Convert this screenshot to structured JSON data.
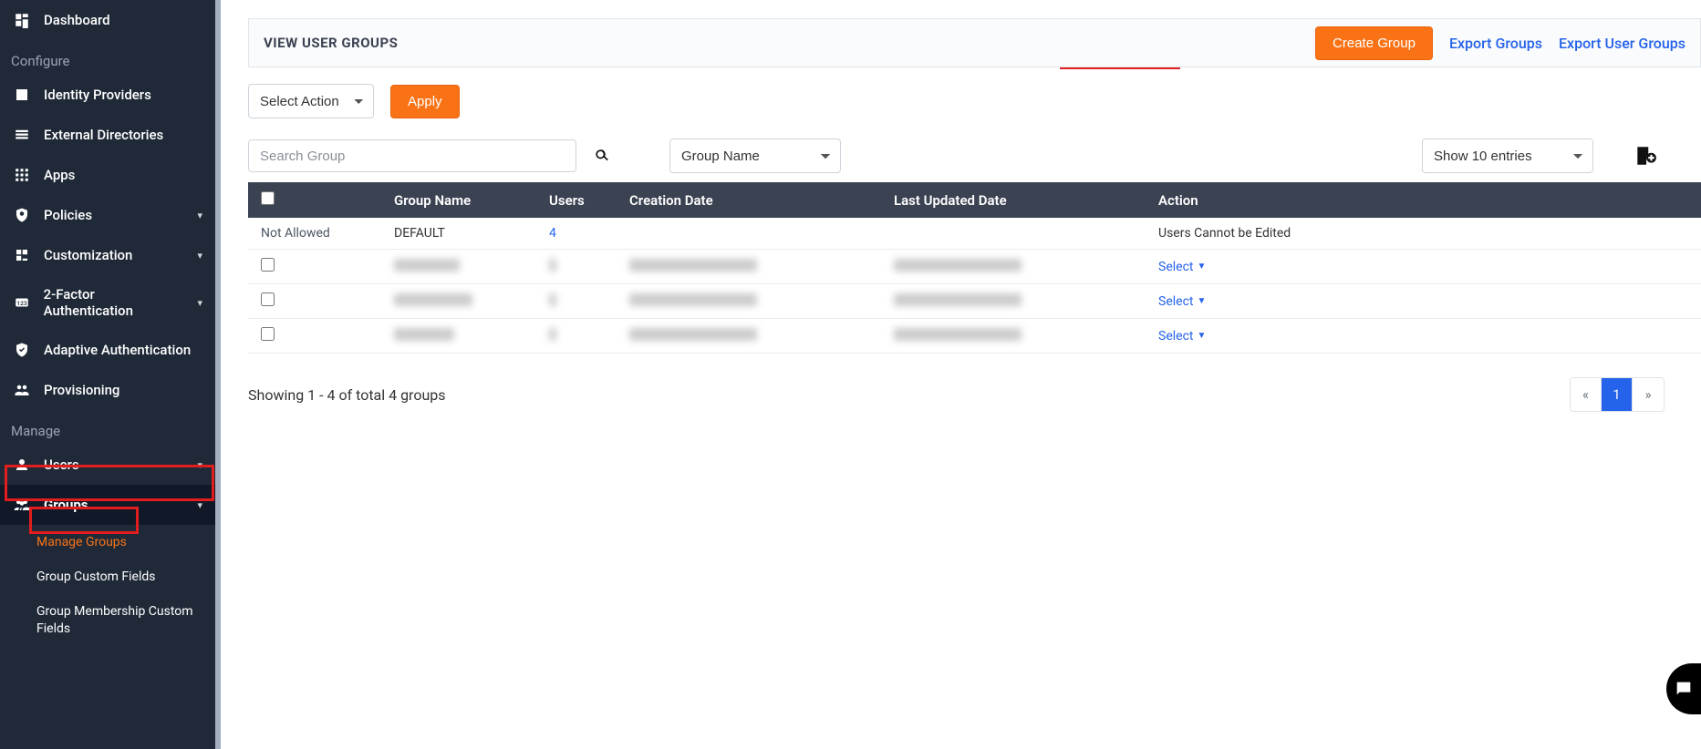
{
  "sidebar": {
    "dashboard": "Dashboard",
    "section_configure": "Configure",
    "identity_providers": "Identity Providers",
    "external_directories": "External Directories",
    "apps": "Apps",
    "policies": "Policies",
    "customization": "Customization",
    "two_factor": "2-Factor Authentication",
    "adaptive_auth": "Adaptive Authentication",
    "provisioning": "Provisioning",
    "section_manage": "Manage",
    "users": "Users",
    "groups": "Groups",
    "manage_groups": "Manage Groups",
    "group_custom_fields": "Group Custom Fields",
    "group_membership_custom_fields": "Group Membership Custom Fields"
  },
  "header": {
    "title": "VIEW USER GROUPS",
    "create_group": "Create Group",
    "export_groups": "Export Groups",
    "export_user_groups": "Export User Groups"
  },
  "toolbar": {
    "select_action": "Select Action",
    "apply": "Apply"
  },
  "filter": {
    "search_placeholder": "Search Group",
    "group_name_filter": "Group Name",
    "entries": "Show 10 entries"
  },
  "table": {
    "headers": {
      "group_name": "Group Name",
      "users": "Users",
      "creation_date": "Creation Date",
      "last_updated": "Last Updated Date",
      "action": "Action"
    },
    "row0": {
      "not_allowed": "Not Allowed",
      "group": "DEFAULT",
      "users": "4",
      "action": "Users Cannot be Edited"
    },
    "select_label": "Select"
  },
  "footer": {
    "showing": "Showing 1 - 4 of total 4 groups",
    "prev": "«",
    "page1": "1",
    "next": "»"
  }
}
